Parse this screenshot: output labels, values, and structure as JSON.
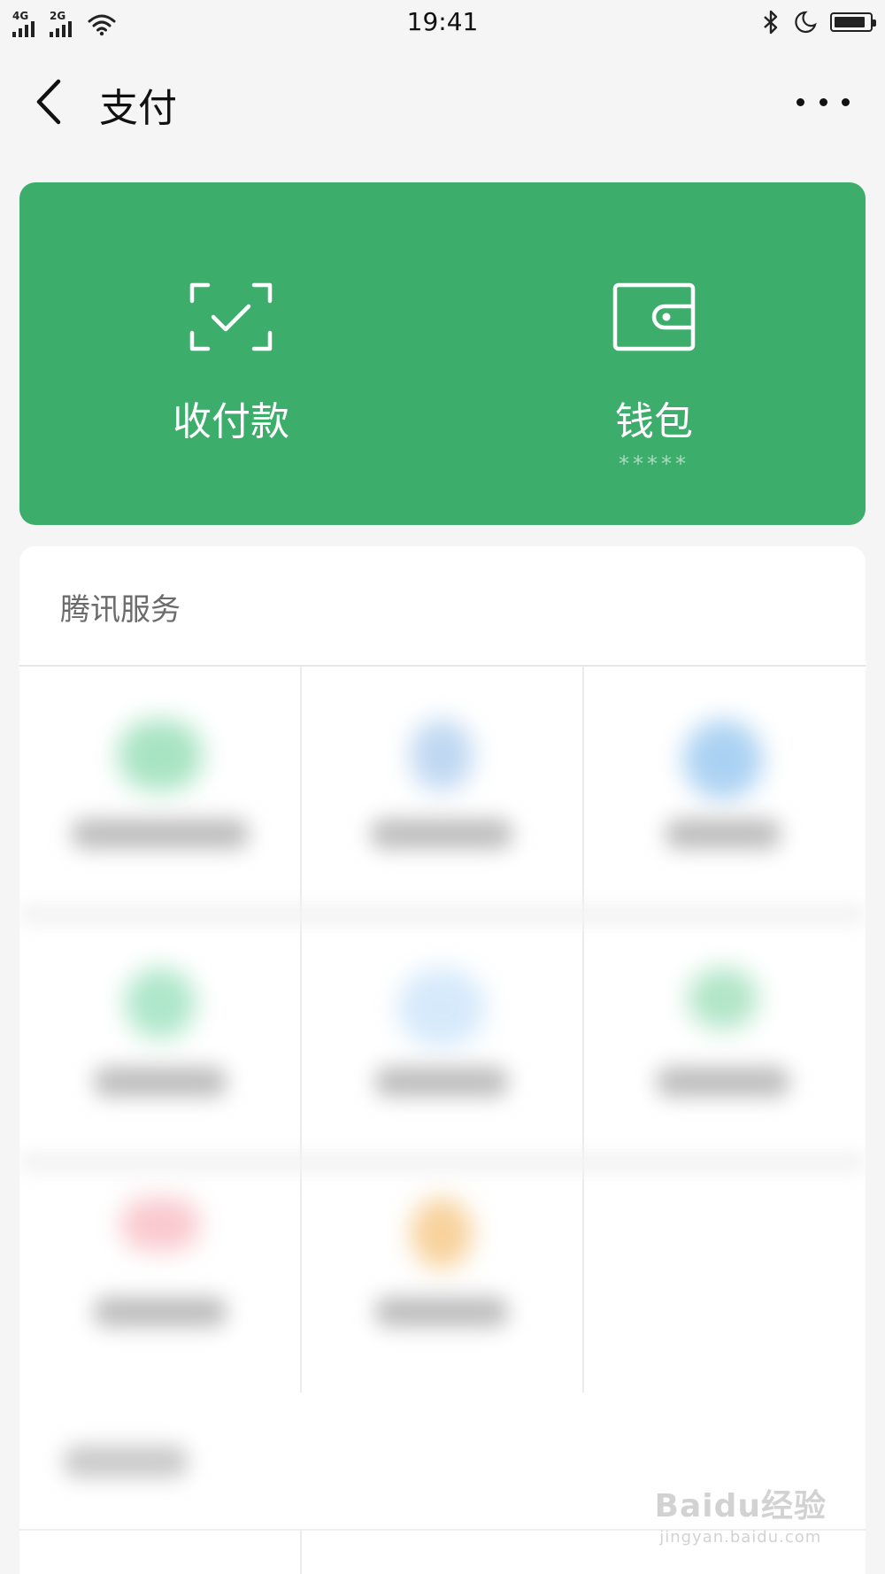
{
  "status_bar": {
    "network1": "4G",
    "network2": "2G",
    "time": "19:41",
    "icons": [
      "signal-icon",
      "wifi-icon",
      "bluetooth-icon",
      "moon-icon",
      "battery-icon"
    ],
    "battery_level": 0.8
  },
  "nav": {
    "title": "支付",
    "back_icon": "chevron-left-icon",
    "more_icon": "more-dots-icon"
  },
  "pay_card": {
    "color": "#3dad6c",
    "items": [
      {
        "label": "收付款",
        "icon": "scan-check-icon"
      },
      {
        "label": "钱包",
        "sub": "*****",
        "icon": "wallet-icon"
      }
    ]
  },
  "services": {
    "title": "腾讯服务",
    "tile_colors": [
      "#3fc37a",
      "#4a8fd9",
      "#2f8fe0",
      "#35c27a",
      "#78b8f2",
      "#3fbf74",
      "#f07a86",
      "#f0a53a"
    ]
  },
  "watermark": {
    "main": "Baidu经验",
    "sub": "jingyan.baidu.com"
  }
}
